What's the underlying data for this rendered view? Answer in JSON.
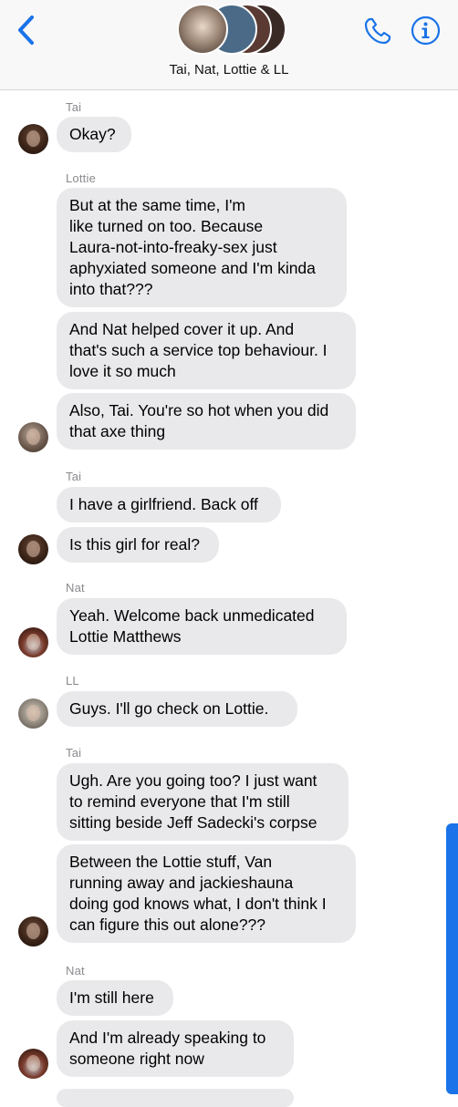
{
  "header": {
    "title": "Tai, Nat, Lottie & LL",
    "back_icon": "chevron-left-icon",
    "phone_icon": "phone-icon",
    "info_icon": "info-icon",
    "accent_color": "#1a73e8"
  },
  "messages": [
    {
      "sender": "Tai",
      "text": "Okay?"
    },
    {
      "sender": "Lottie",
      "text": "But at the same time, I'm\nlike turned on too. Because\nLaura-not-into-freaky-sex just\naphyxiated someone and I'm kinda\ninto that???"
    },
    {
      "text": "And Nat helped cover it up. And\nthat's such a service top behaviour. I\nlove it so much"
    },
    {
      "text": "Also, Tai. You're so hot when you did\nthat axe thing"
    },
    {
      "sender": "Tai",
      "text": "I have a girlfriend. Back off"
    },
    {
      "text": "Is this girl for real?"
    },
    {
      "sender": "Nat",
      "text": "Yeah. Welcome back unmedicated\nLottie Matthews"
    },
    {
      "sender": "LL",
      "text": "Guys. I'll go check on Lottie."
    },
    {
      "sender": "Tai",
      "text": "Ugh. Are you going too? I just want\nto remind everyone that I'm still\nsitting beside Jeff Sadecki's corpse"
    },
    {
      "text": "Between the Lottie stuff, Van\nrunning away and jackieshauna\ndoing god knows what, I don't think I\ncan figure this out alone???"
    },
    {
      "sender": "Nat",
      "text": "I'm still here"
    },
    {
      "text": "And I'm already speaking to\nsomeone right now"
    }
  ]
}
